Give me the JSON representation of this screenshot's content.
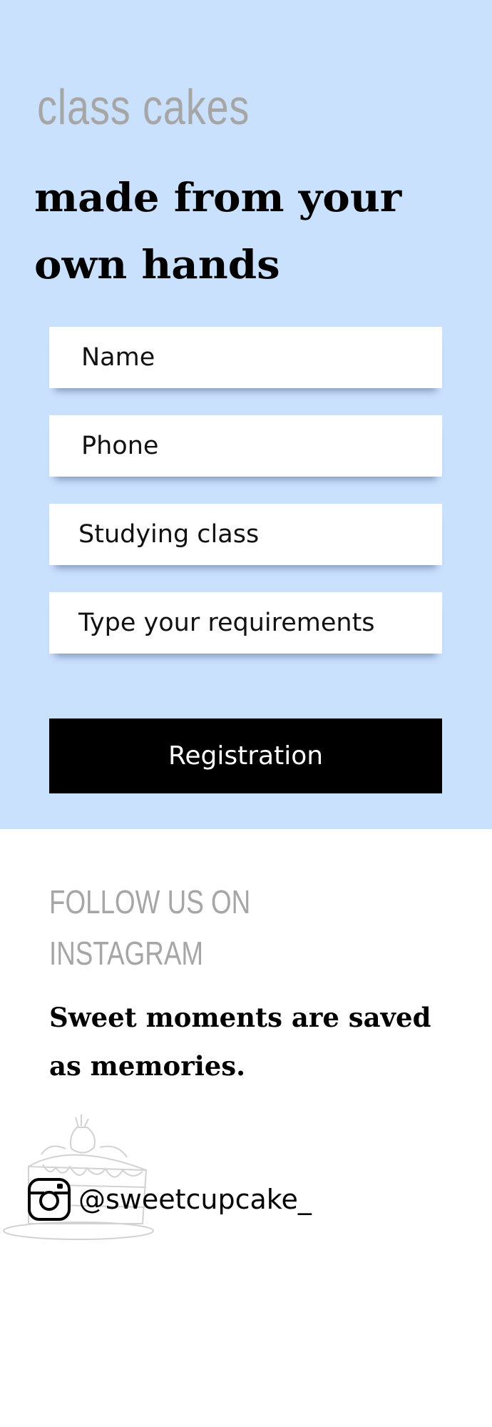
{
  "hero": {
    "kicker": "class cakes",
    "headline_line1": "made from your",
    "headline_line2": "own hands"
  },
  "form": {
    "fields": [
      {
        "label": "Name"
      },
      {
        "label": "Phone"
      },
      {
        "label": "Studying class"
      },
      {
        "label": "Type your requirements"
      }
    ],
    "submit_label": "Registration"
  },
  "instagram": {
    "heading_line1": "FOLLOW US ON",
    "heading_line2": "INSTAGRAM",
    "tagline_line1": "Sweet moments are saved",
    "tagline_line2": "as memories.",
    "handle": "@sweetcupcake_",
    "icon": "instagram-icon",
    "illustration": "cake-slice-illustration"
  },
  "colors": {
    "hero_background": "#cae1fe",
    "button_background": "#000000",
    "muted_text": "#a6a6a6"
  }
}
